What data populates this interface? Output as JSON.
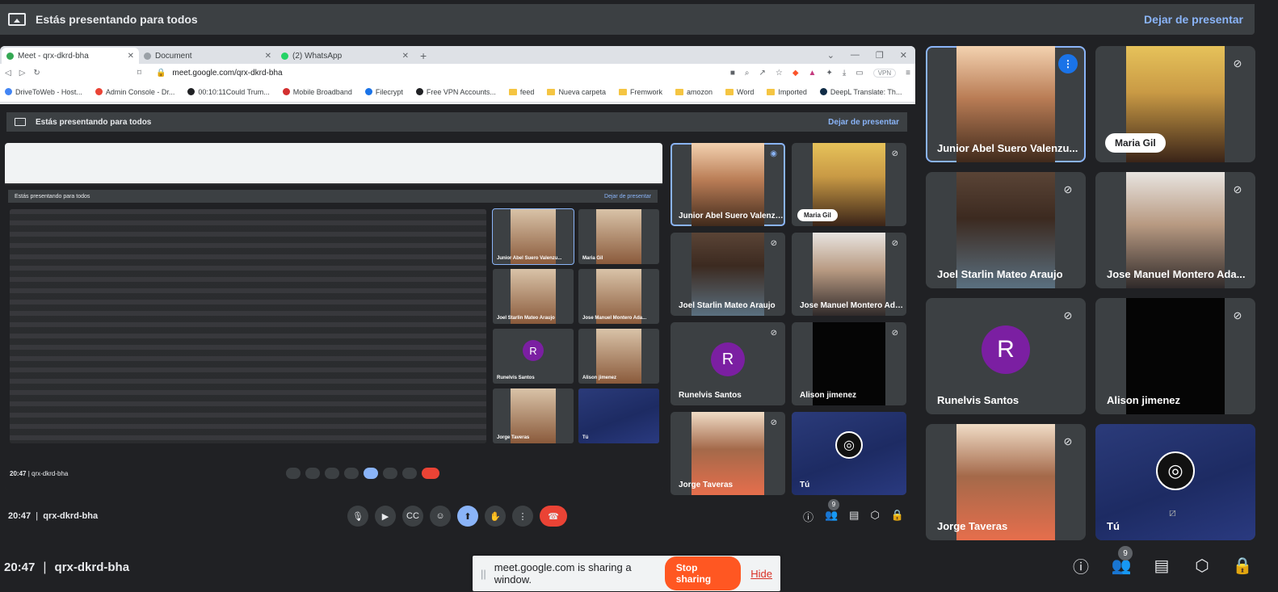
{
  "banner": {
    "text": "Estás presentando para todos",
    "stop": "Dejar de presentar"
  },
  "browser": {
    "tabs": [
      "Meet - qrx-dkrd-bha",
      "Document",
      "(2) WhatsApp"
    ],
    "url": "meet.google.com/qrx-dkrd-bha",
    "vpn": "VPN",
    "bookmarks": [
      "DriveToWeb - Host...",
      "Admin Console - Dr...",
      "00:10:11Could Trum...",
      "Mobile Broadband",
      "Filecrypt",
      "Free VPN Accounts...",
      "feed",
      "Nueva carpeta",
      "Fremwork",
      "amozon",
      "Word",
      "Imported",
      "DeepL Translate: Th..."
    ]
  },
  "inner": {
    "banner_text": "Estás presentando para todos",
    "banner_stop": "Dejar de presentar",
    "time": "20:47",
    "code": "qrx-dkrd-bha",
    "badge": "9",
    "nested_time": "20:47",
    "nested_code": "qrx-dkrd-bha"
  },
  "participants": [
    {
      "name": "Junior Abel Suero Valenzu...",
      "type": "cam",
      "face": "f1",
      "speaking": true
    },
    {
      "name": "Maria Gil",
      "type": "cam",
      "face": "f2",
      "pill": true
    },
    {
      "name": "Joel Starlin Mateo Araujo",
      "type": "cam",
      "face": "f3"
    },
    {
      "name": "Jose Manuel Montero Ada...",
      "type": "cam",
      "face": "f4"
    },
    {
      "name": "Runelvis Santos",
      "type": "avatar",
      "initial": "R"
    },
    {
      "name": "Alison jimenez",
      "type": "black"
    },
    {
      "name": "Jorge Taveras",
      "type": "cam",
      "face": "f5"
    },
    {
      "name": "Tú",
      "type": "self"
    }
  ],
  "bottom": {
    "time": "20:47",
    "separator": "|",
    "code": "qrx-dkrd-bha",
    "people_count": "9"
  },
  "share_bar": {
    "text": "meet.google.com is sharing a window.",
    "stop": "Stop sharing",
    "hide": "Hide"
  },
  "colors": {
    "accent": "#8ab4f8",
    "end_call": "#ea4335",
    "stop_share": "#ff5722",
    "avatar": "#7b1fa2",
    "speaking": "#1a73e8"
  }
}
